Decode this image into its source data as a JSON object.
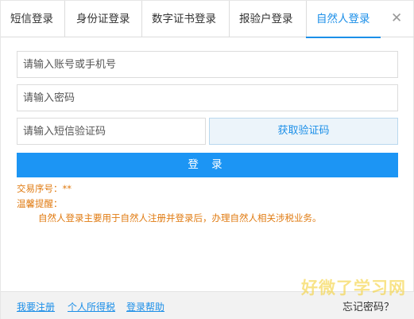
{
  "tabs": [
    {
      "label": "短信登录"
    },
    {
      "label": "身份证登录"
    },
    {
      "label": "数字证书登录"
    },
    {
      "label": "报验户登录"
    },
    {
      "label": "自然人登录",
      "active": true
    }
  ],
  "close_symbol": "✕",
  "form": {
    "account_placeholder": "请输入账号或手机号",
    "password_placeholder": "请输入密码",
    "sms_code_placeholder": "请输入短信验证码",
    "get_code_label": "获取验证码",
    "login_label": "登 录"
  },
  "info": {
    "transaction_no": "交易序号：**",
    "reminder_title": "温馨提醒：",
    "reminder_text": "自然人登录主要用于自然人注册并登录后，办理自然人相关涉税业务。"
  },
  "footer": {
    "register": "我要注册",
    "personal_tax": "个人所得税",
    "login_help": "登录帮助",
    "forgot_password": "忘记密码？"
  },
  "watermark": "好微了学习网",
  "colors": {
    "accent": "#1c8fe8",
    "button": "#1c95f4",
    "notice": "#e07b12"
  }
}
